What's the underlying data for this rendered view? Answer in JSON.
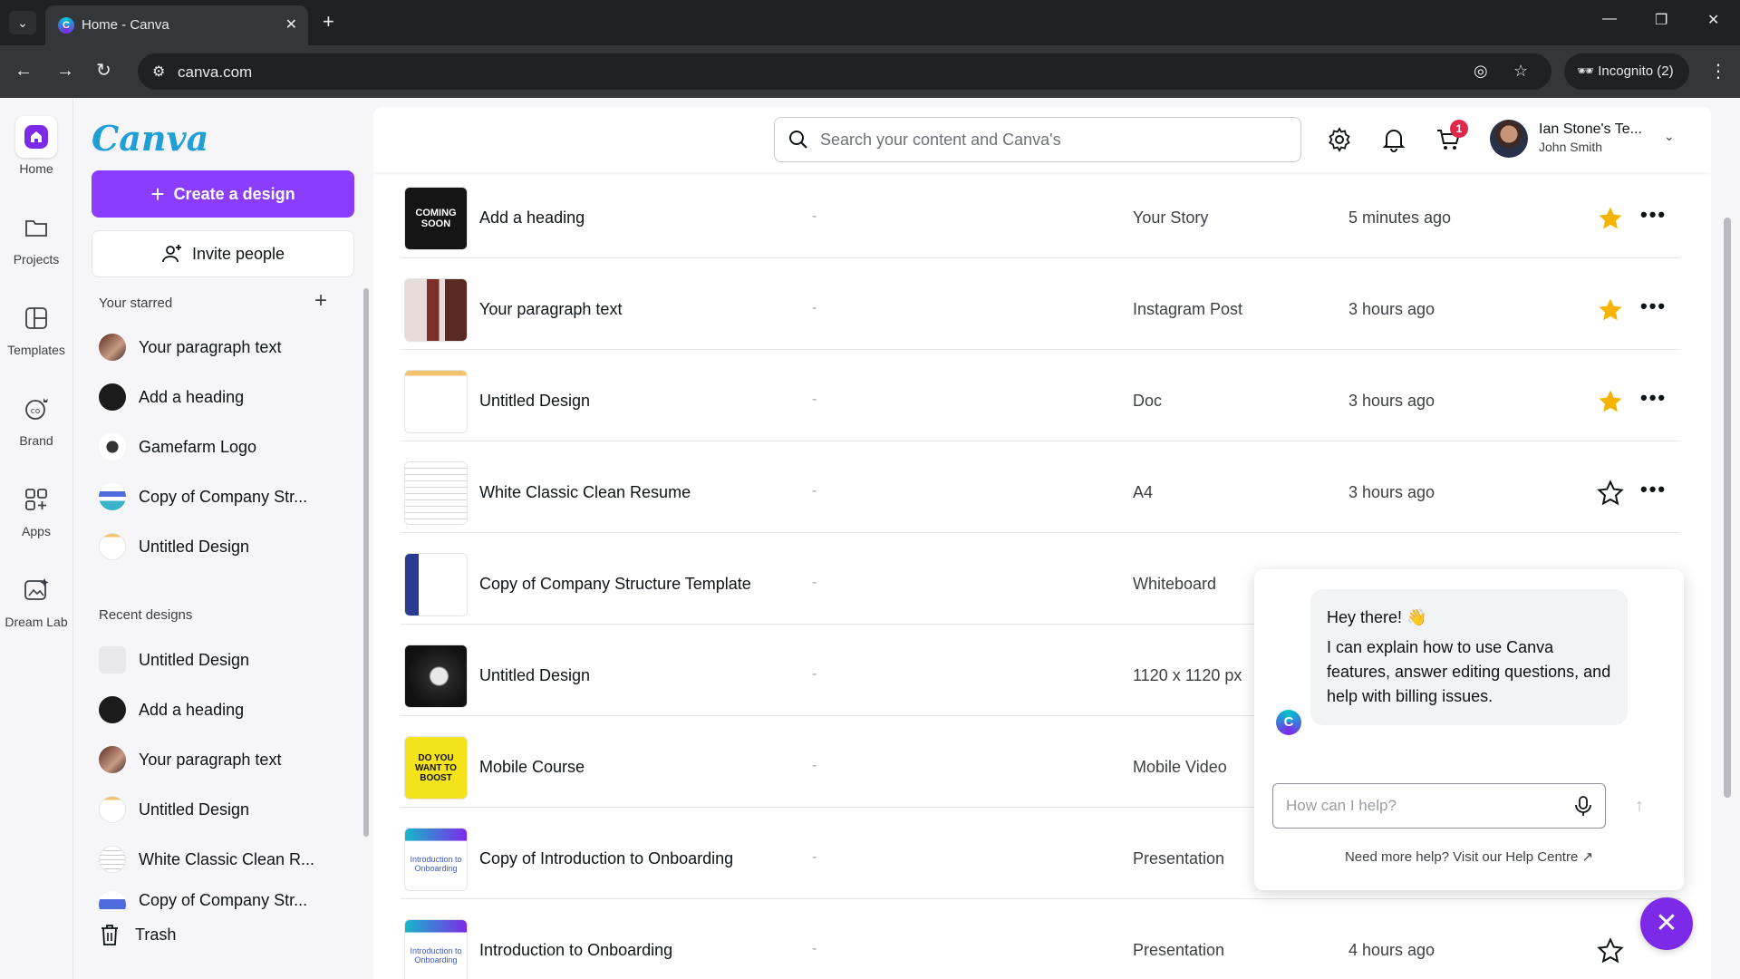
{
  "browser": {
    "tab_title": "Home - Canva",
    "url": "canva.com",
    "incognito_label": "Incognito (2)"
  },
  "rail": {
    "items": [
      {
        "label": "Home",
        "icon": "home-icon"
      },
      {
        "label": "Projects",
        "icon": "folder-icon"
      },
      {
        "label": "Templates",
        "icon": "template-icon"
      },
      {
        "label": "Brand",
        "icon": "brand-icon"
      },
      {
        "label": "Apps",
        "icon": "apps-icon"
      },
      {
        "label": "Dream Lab",
        "icon": "dreamlab-icon"
      }
    ]
  },
  "sidebar": {
    "logo": "Canva",
    "create_label": "Create a design",
    "invite_label": "Invite people",
    "starred_heading": "Your starred",
    "starred": [
      {
        "label": "Your paragraph text"
      },
      {
        "label": "Add a heading"
      },
      {
        "label": "Gamefarm Logo"
      },
      {
        "label": "Copy of Company Str..."
      },
      {
        "label": "Untitled Design"
      }
    ],
    "recent_heading": "Recent designs",
    "recent": [
      {
        "label": "Untitled Design"
      },
      {
        "label": "Add a heading"
      },
      {
        "label": "Your paragraph text"
      },
      {
        "label": "Untitled Design"
      },
      {
        "label": "White Classic Clean R..."
      },
      {
        "label": "Copy of Company Str..."
      }
    ],
    "trash_label": "Trash"
  },
  "header": {
    "search_placeholder": "Search your content and Canva's",
    "cart_count": "1",
    "account_name": "Ian Stone's Te...",
    "account_user": "John Smith"
  },
  "designs": [
    {
      "name": "Add a heading",
      "owner": "-",
      "type": "Your Story",
      "time": "5 minutes ago",
      "starred": true
    },
    {
      "name": "Your paragraph text",
      "owner": "-",
      "type": "Instagram Post",
      "time": "3 hours ago",
      "starred": true
    },
    {
      "name": "Untitled Design",
      "owner": "-",
      "type": "Doc",
      "time": "3 hours ago",
      "starred": true
    },
    {
      "name": "White Classic Clean Resume",
      "owner": "-",
      "type": "A4",
      "time": "3 hours ago",
      "starred": false
    },
    {
      "name": "Copy of Company Structure Template",
      "owner": "-",
      "type": "Whiteboard",
      "time": "",
      "starred": false
    },
    {
      "name": "Untitled Design",
      "owner": "-",
      "type": "1120 x 1120 px",
      "time": "",
      "starred": false
    },
    {
      "name": "Mobile Course",
      "owner": "-",
      "type": "Mobile Video",
      "time": "",
      "starred": false
    },
    {
      "name": "Copy of Introduction to Onboarding",
      "owner": "-",
      "type": "Presentation",
      "time": "",
      "starred": false
    },
    {
      "name": "Introduction to Onboarding",
      "owner": "-",
      "type": "Presentation",
      "time": "4 hours ago",
      "starred": false
    }
  ],
  "chat": {
    "greeting": "Hey there! 👋",
    "message": "I can explain how to use Canva features, answer editing questions, and help with billing issues.",
    "input_placeholder": "How can I help?",
    "help_link": "Need more help? Visit our Help Centre"
  },
  "colors": {
    "accent": "#8b3dff",
    "star": "#f5b400",
    "badge": "#e0284d"
  }
}
